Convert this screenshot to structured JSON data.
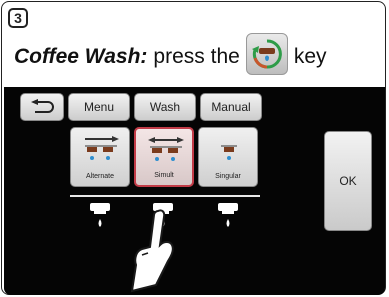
{
  "step": {
    "number": "3"
  },
  "instruction": {
    "strong": "Coffee Wash:",
    "rest": "press the",
    "after": "key",
    "key_icon": "coffee-wash-key-icon"
  },
  "toolbar": {
    "back_icon": "back-arrow-icon",
    "menu": "Menu",
    "wash": "Wash",
    "manual": "Manual"
  },
  "modes": {
    "alternate": "Alternate",
    "simult": "Simult",
    "singular": "Singular",
    "selected": "Simult"
  },
  "ok": "OK",
  "colors": {
    "screen": "#050505",
    "selected_border": "#c23b47",
    "water": "#2f8fd0"
  }
}
